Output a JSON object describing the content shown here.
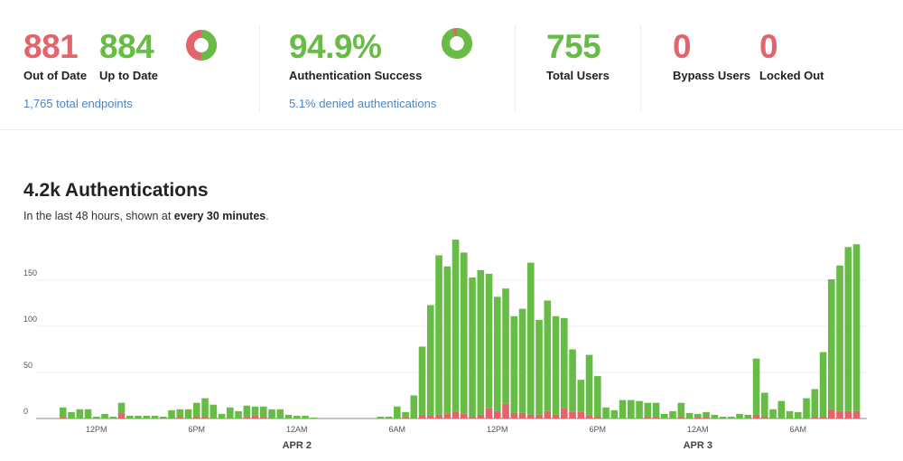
{
  "colors": {
    "success": "#67bc46",
    "denied": "#e3646b",
    "link": "#4a86c5"
  },
  "endpoints": {
    "out_of_date": {
      "value": "881",
      "label": "Out of Date"
    },
    "up_to_date": {
      "value": "884",
      "label": "Up to Date"
    },
    "donut_fraction_up_to_date": 0.501,
    "total_link": "1,765 total endpoints"
  },
  "authentication": {
    "success_rate": "94.9%",
    "label": "Authentication Success",
    "donut_fraction_success": 0.949,
    "denied_link": "5.1% denied authentications"
  },
  "users": {
    "total": {
      "value": "755",
      "label": "Total Users"
    },
    "bypass": {
      "value": "0",
      "label": "Bypass Users"
    },
    "locked": {
      "value": "0",
      "label": "Locked Out"
    }
  },
  "chart_section": {
    "title": "4.2k Authentications",
    "subtitle_prefix": "In the last 48 hours, shown at ",
    "subtitle_bold": "every 30 minutes",
    "subtitle_suffix": "."
  },
  "chart_data": {
    "type": "bar",
    "stacked": true,
    "interval": "30 minutes",
    "ylim": [
      0,
      195
    ],
    "y_ticks": [
      0,
      50,
      100,
      150
    ],
    "grid": true,
    "x_tick_labels": [
      {
        "label": "12PM",
        "at": 4
      },
      {
        "label": "6PM",
        "at": 16
      },
      {
        "label": "12AM",
        "at": 28
      },
      {
        "label": "6AM",
        "at": 40
      },
      {
        "label": "12PM",
        "at": 52
      },
      {
        "label": "6PM",
        "at": 64
      },
      {
        "label": "12AM",
        "at": 76
      },
      {
        "label": "6AM",
        "at": 88
      }
    ],
    "date_labels": [
      {
        "label": "APR 2",
        "at": 28
      },
      {
        "label": "APR 3",
        "at": 76
      }
    ],
    "totals": [
      12,
      7,
      10,
      10,
      2,
      5,
      2,
      17,
      3,
      3,
      3,
      3,
      2,
      9,
      10,
      10,
      17,
      22,
      15,
      5,
      12,
      8,
      14,
      13,
      13,
      10,
      10,
      4,
      3,
      3,
      1,
      0,
      0,
      0,
      0,
      0,
      0,
      0,
      2,
      2,
      13,
      7,
      25,
      78,
      123,
      177,
      165,
      194,
      180,
      153,
      161,
      157,
      132,
      141,
      111,
      119,
      169,
      107,
      128,
      111,
      109,
      75,
      42,
      69,
      46,
      12,
      9,
      20,
      20,
      19,
      17,
      17,
      5,
      8,
      17,
      6,
      5,
      7,
      4,
      2,
      2,
      5,
      4,
      65,
      28,
      10,
      19,
      8,
      7,
      22,
      32,
      72,
      151,
      166,
      186,
      189
    ],
    "denied": [
      1,
      0,
      0,
      0,
      0,
      0,
      0,
      6,
      0,
      0,
      0,
      0,
      0,
      0,
      1,
      0,
      2,
      2,
      0,
      0,
      0,
      0,
      1,
      3,
      1,
      0,
      0,
      0,
      0,
      0,
      0,
      0,
      0,
      0,
      0,
      0,
      0,
      0,
      0,
      0,
      0,
      1,
      0,
      4,
      3,
      4,
      5,
      7,
      5,
      2,
      4,
      11,
      8,
      16,
      6,
      6,
      4,
      4,
      8,
      4,
      11,
      7,
      7,
      3,
      2,
      0,
      0,
      0,
      0,
      0,
      1,
      1,
      0,
      0,
      1,
      0,
      1,
      1,
      0,
      0,
      0,
      0,
      0,
      4,
      2,
      0,
      0,
      0,
      0,
      0,
      1,
      2,
      10,
      8,
      8,
      8
    ]
  }
}
